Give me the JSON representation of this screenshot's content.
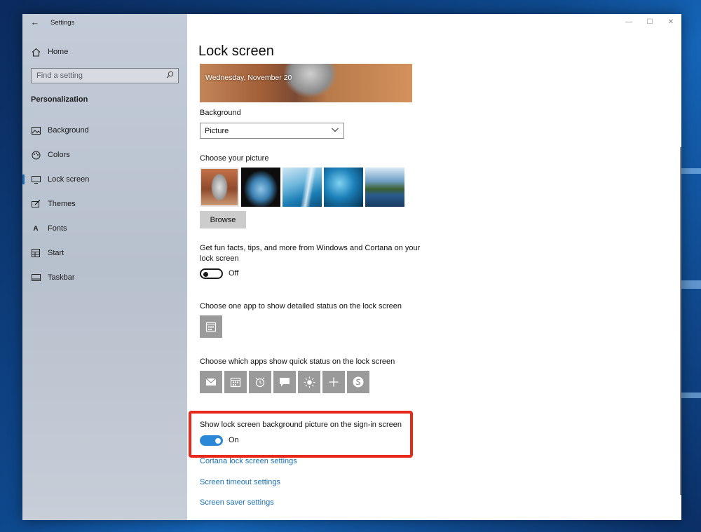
{
  "window": {
    "app_title": "Settings",
    "controls": {
      "minimize": "—",
      "maximize": "☐",
      "close": "✕"
    }
  },
  "sidebar": {
    "home_label": "Home",
    "search_placeholder": "Find a setting",
    "section_title": "Personalization",
    "items": [
      {
        "label": "Background",
        "icon": "background-icon"
      },
      {
        "label": "Colors",
        "icon": "colors-icon"
      },
      {
        "label": "Lock screen",
        "icon": "lock-screen-icon",
        "selected": true
      },
      {
        "label": "Themes",
        "icon": "themes-icon"
      },
      {
        "label": "Fonts",
        "icon": "fonts-icon"
      },
      {
        "label": "Start",
        "icon": "start-icon"
      },
      {
        "label": "Taskbar",
        "icon": "taskbar-icon"
      }
    ]
  },
  "main": {
    "page_title": "Lock screen",
    "preview_date": "Wednesday, November 20",
    "background_label": "Background",
    "background_value": "Picture",
    "choose_picture_label": "Choose your picture",
    "browse_label": "Browse",
    "fun_facts_text": "Get fun facts, tips, and more from Windows and Cortana on your lock screen",
    "fun_facts_state": "Off",
    "detailed_status_label": "Choose one app to show detailed status on the lock screen",
    "quick_status_label": "Choose which apps show quick status on the lock screen",
    "quick_status_apps": [
      "mail-icon",
      "calendar-icon",
      "alarm-icon",
      "message-icon",
      "weather-icon",
      "add-icon",
      "skype-icon"
    ],
    "signin_bg_text": "Show lock screen background picture on the sign-in screen",
    "signin_bg_state": "On",
    "links": {
      "cortana": "Cortana lock screen settings",
      "timeout": "Screen timeout settings",
      "saver": "Screen saver settings"
    }
  },
  "colors": {
    "accent": "#2b88d8",
    "highlight": "#e8281a",
    "link": "#1b6fb0"
  }
}
